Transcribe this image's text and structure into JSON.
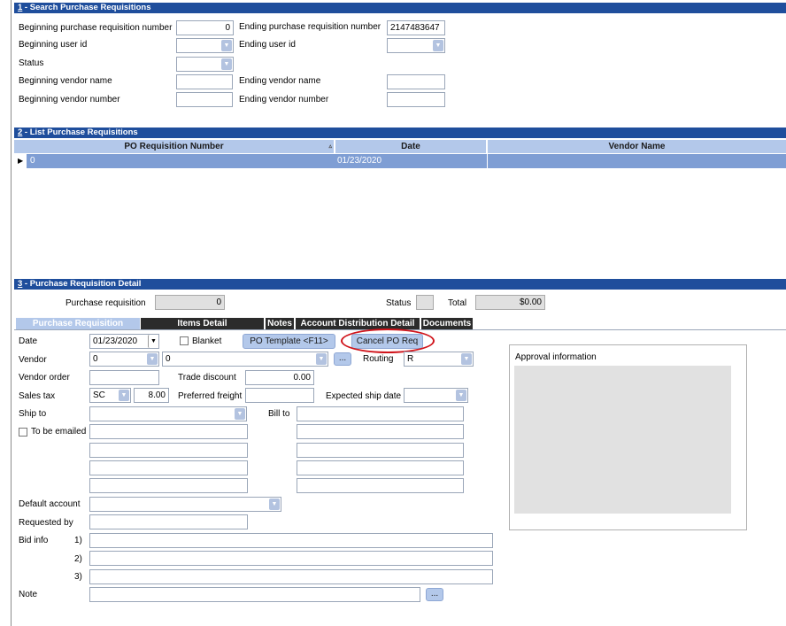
{
  "search": {
    "title_num": "1",
    "title": " - Search Purchase Requisitions",
    "beg_req_label": "Beginning purchase requisition number",
    "beg_req_value": "0",
    "end_req_label": "Ending purchase requisition number",
    "end_req_value": "2147483647",
    "beg_user_label": "Beginning user id",
    "end_user_label": "Ending user id",
    "status_label": "Status",
    "beg_vendor_name_label": "Beginning vendor name",
    "end_vendor_name_label": "Ending vendor name",
    "beg_vendor_num_label": "Beginning vendor number",
    "end_vendor_num_label": "Ending vendor number"
  },
  "list": {
    "title_num": "2",
    "title": " - List Purchase Requisitions",
    "columns": [
      "PO Requisition Number",
      "Date",
      "Vendor Name"
    ],
    "rows": [
      {
        "number": "0",
        "date": "01/23/2020",
        "vendor": ""
      }
    ]
  },
  "detail": {
    "title_num": "3",
    "title": " - Purchase Requisition Detail",
    "req_label": "Purchase requisition",
    "req_value": "0",
    "status_label": "Status",
    "total_label": "Total",
    "total_value": "$0.00",
    "tabs": [
      "Purchase Requisition",
      "Items Detail",
      "Notes",
      "Account Distribution Detail",
      "Documents"
    ],
    "date_label": "Date",
    "date_value": "01/23/2020",
    "blanket_label": "Blanket",
    "po_template_button": "PO Template <F11>",
    "cancel_po_button": "Cancel PO Req",
    "vendor_label": "Vendor",
    "vendor_value": "0",
    "vendor_name_value": "0",
    "ellipsis": "...",
    "routing_label": "Routing",
    "routing_value": "R",
    "vendor_order_label": "Vendor order",
    "trade_discount_label": "Trade discount",
    "trade_discount_value": "0.00",
    "sales_tax_label": "Sales tax",
    "sales_tax_code": "SC",
    "sales_tax_rate": "8.00",
    "pref_freight_label": "Preferred freight",
    "expected_ship_label": "Expected ship date",
    "ship_to_label": "Ship to",
    "bill_to_label": "Bill to",
    "to_be_emailed_label": "To be emailed",
    "default_account_label": "Default account",
    "requested_by_label": "Requested by",
    "bid_info_label": "Bid info",
    "bid_1": "1)",
    "bid_2": "2)",
    "bid_3": "3)",
    "note_label": "Note",
    "approval_label": "Approval information"
  },
  "colors": {
    "header_bg": "#1f4e9c",
    "accent": "#b3c8ea",
    "selected_row": "#7f9ed4",
    "highlight_circle": "#d0141b"
  }
}
